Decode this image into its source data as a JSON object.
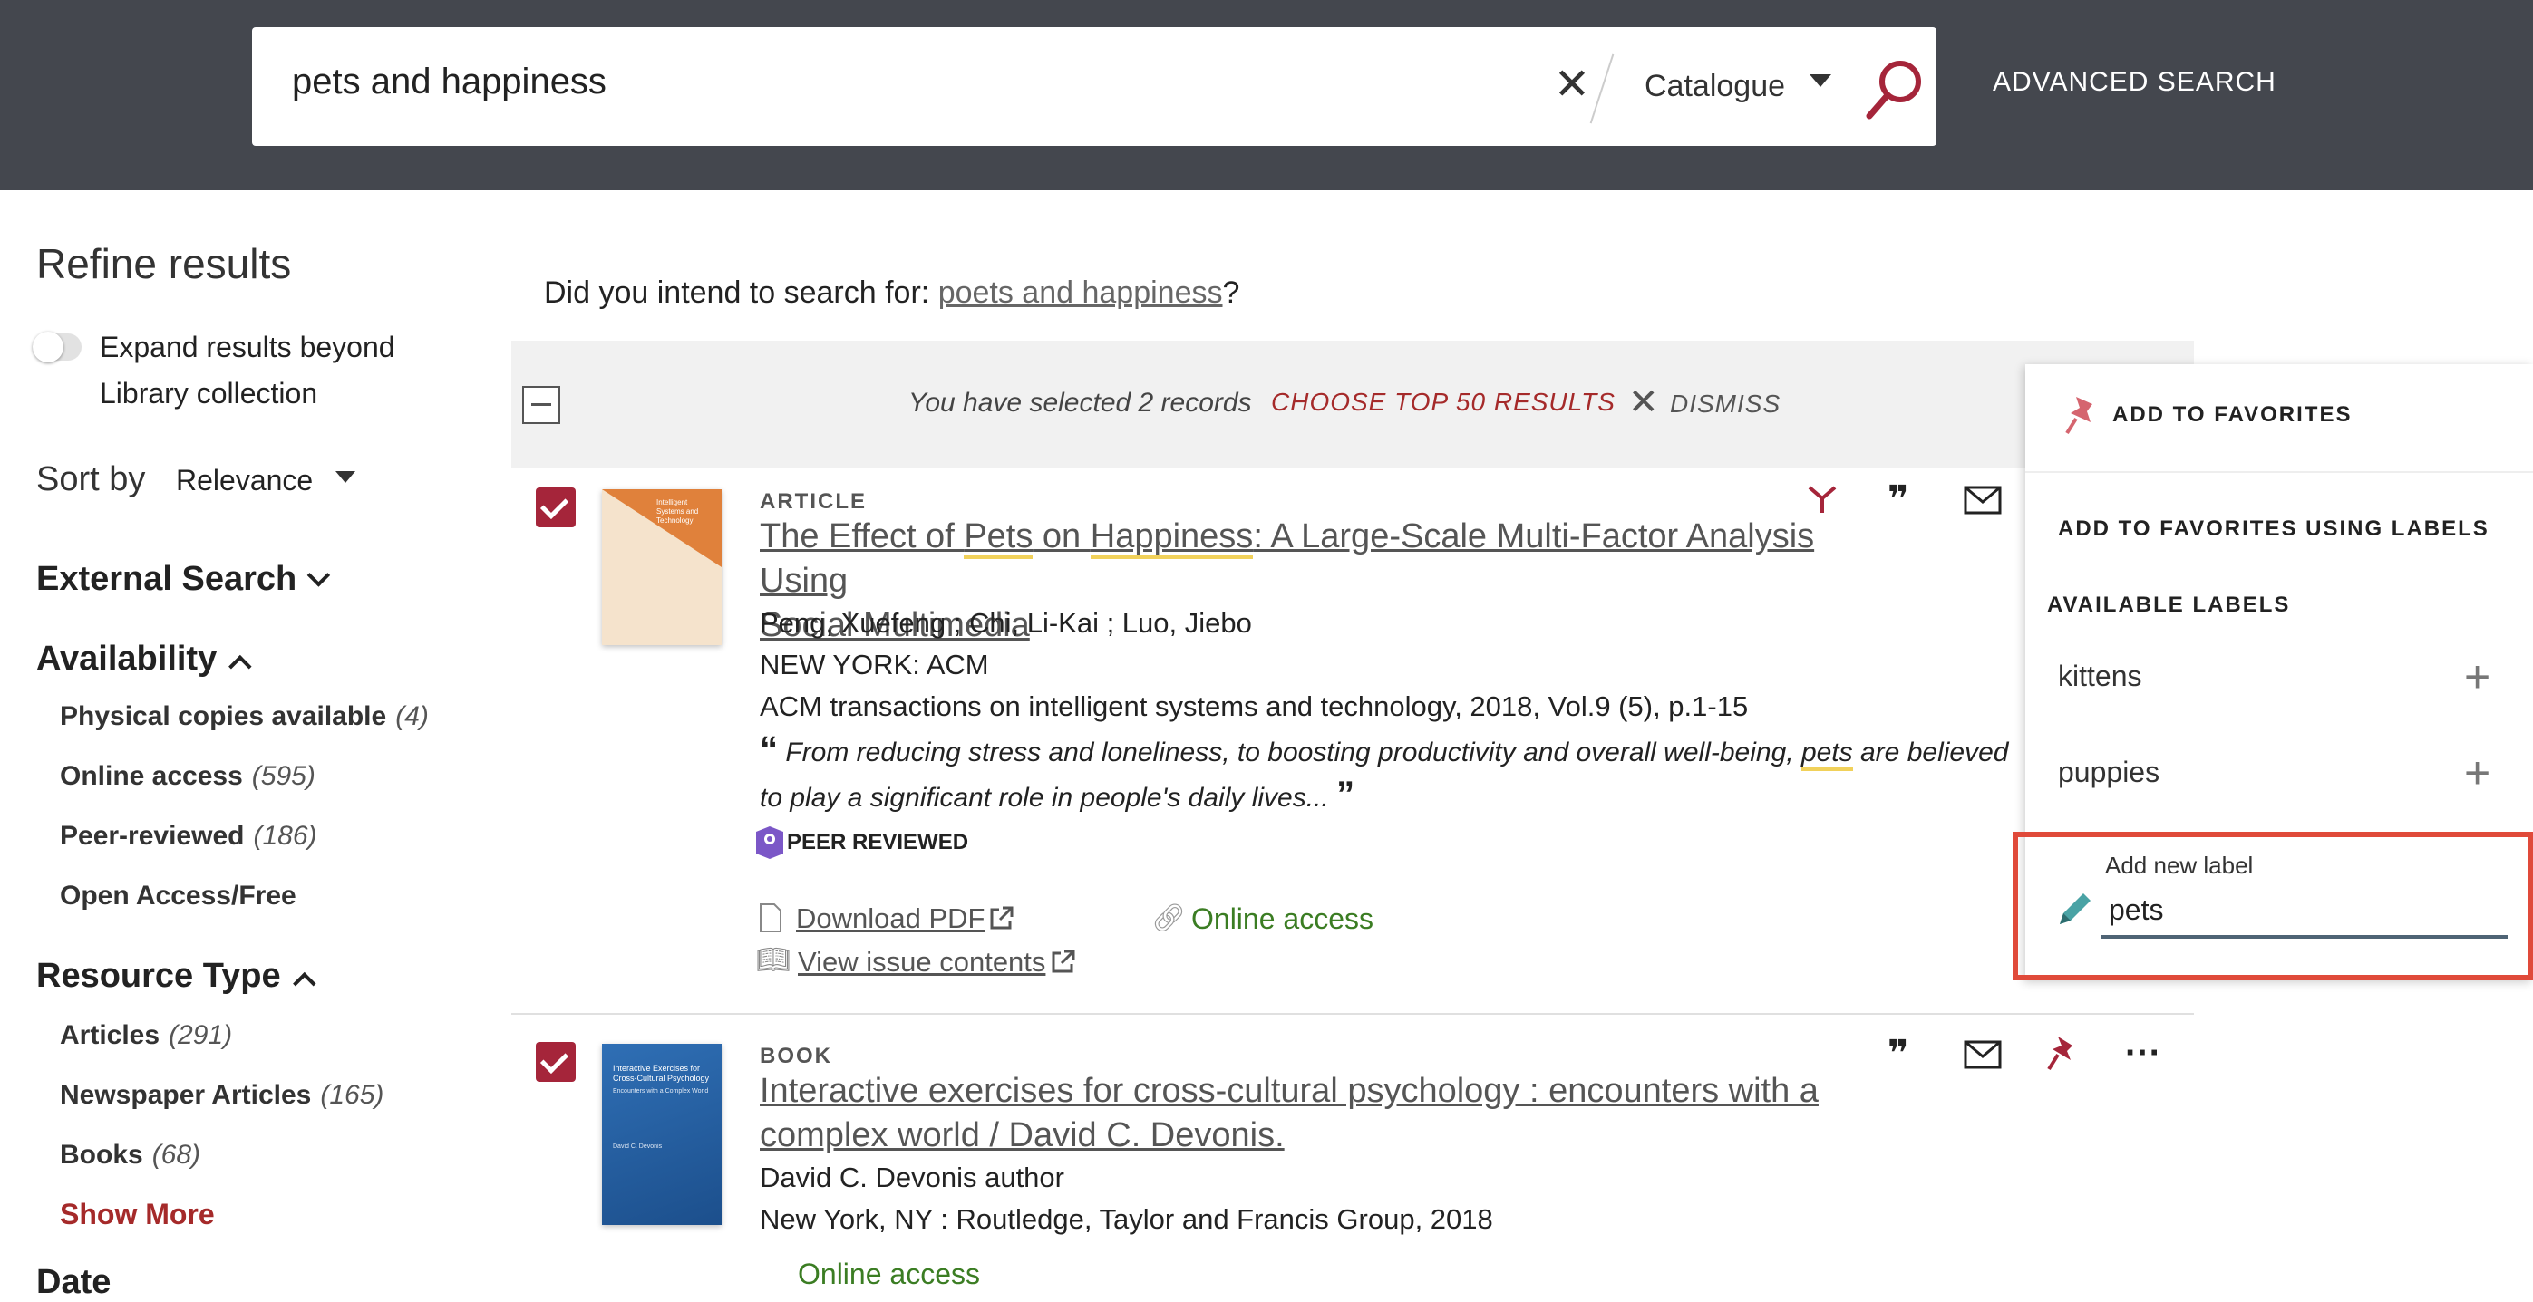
{
  "header": {
    "search_value": "pets and happiness",
    "clear_icon": "close-icon",
    "scope": "Catalogue",
    "search_icon": "search-icon",
    "advanced_search": "ADVANCED SEARCH"
  },
  "sidebar": {
    "title": "Refine results",
    "expand_label": "Expand results beyond Library collection",
    "sort_label": "Sort by",
    "sort_value": "Relevance",
    "external_search": "External Search",
    "availability": {
      "heading": "Availability",
      "items": [
        {
          "label": "Physical copies available",
          "count": "(4)"
        },
        {
          "label": "Online access",
          "count": "(595)"
        },
        {
          "label": "Peer-reviewed",
          "count": "(186)"
        },
        {
          "label": "Open Access/Free",
          "count": ""
        }
      ]
    },
    "resource_type": {
      "heading": "Resource Type",
      "items": [
        {
          "label": "Articles",
          "count": "(291)"
        },
        {
          "label": "Newspaper Articles",
          "count": "(165)"
        },
        {
          "label": "Books",
          "count": "(68)"
        }
      ],
      "show_more": "Show More"
    },
    "date_heading": "Date"
  },
  "main": {
    "did_you_prefix": "Did you intend to search for:",
    "did_you_link": "poets and happiness",
    "did_you_suffix": "?",
    "selection": {
      "text": "You have selected 2 records",
      "choose_top": "CHOOSE TOP 50 RESULTS",
      "dismiss": "DISMISS"
    },
    "results": [
      {
        "type": "ARTICLE",
        "title_parts": [
          "The Effect of ",
          "Pets",
          " on ",
          "Happiness",
          ": A Large-Scale Multi-Factor Analysis Using"
        ],
        "title_line2": "Social Multimedia",
        "authors": "Peng, Xuefeng ; Chi, Li-Kai ; Luo, Jiebo",
        "publisher": "NEW YORK: ACM",
        "source": "ACM transactions on intelligent systems and technology, 2018, Vol.9 (5), p.1-15",
        "abstract_1a": "From reducing stress and loneliness, to boosting productivity and overall well-being,",
        "abstract_hl": "pets",
        "abstract_1b": "are believed",
        "abstract_2": "to play a significant role in people's daily lives...",
        "badge": "PEER REVIEWED",
        "download_pdf": "Download PDF",
        "online_access": "Online access",
        "view_issue": "View issue contents",
        "thumb_title": "Intelligent Systems and Technology"
      },
      {
        "type": "BOOK",
        "title_line1": "Interactive exercises for cross-cultural psychology : encounters with a",
        "title_line2": "complex world / David C. Devonis.",
        "author": "David C. Devonis author",
        "publisher": "New York, NY : Routledge, Taylor and Francis Group, 2018",
        "online_access": "Online access",
        "thumb_title": "Interactive Exercises for Cross-Cultural Psychology",
        "thumb_sub": "Encounters with a Complex World",
        "thumb_author": "David C. Devonis"
      }
    ]
  },
  "favorites_popup": {
    "add_to_favorites": "ADD TO FAVORITES",
    "using_labels": "ADD TO FAVORITES USING LABELS",
    "available_labels": "AVAILABLE LABELS",
    "labels": [
      "kittens",
      "puppies"
    ],
    "new_label_caption": "Add new label",
    "new_label_value": "pets"
  },
  "colors": {
    "header_bg": "#44474e",
    "accent": "#a5253a",
    "green": "#3b7d23",
    "highlight_box": "#e04a3a"
  }
}
